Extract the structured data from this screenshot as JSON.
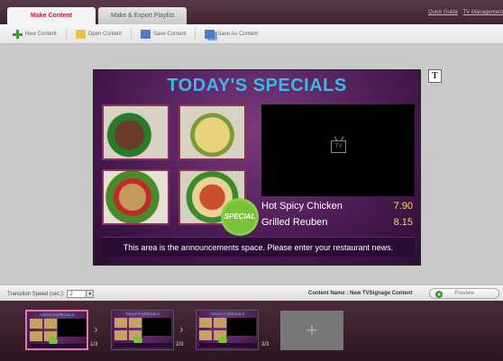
{
  "tabs": [
    {
      "label": "Make Content",
      "active": true
    },
    {
      "label": "Make & Export Playlist",
      "active": false
    }
  ],
  "toplinks": [
    "Quick Guide",
    "TV Management"
  ],
  "toolbar": {
    "new": "New Content",
    "open": "Open Content",
    "save": "Save Content",
    "save_as": "Save As Content"
  },
  "slide": {
    "title": "TODAY'S SPECIALS",
    "special_badge": "SPECIAL",
    "tv_label": "TV",
    "menu": [
      {
        "item": "Hot Spicy Chicken",
        "price": "7.90"
      },
      {
        "item": "Grilled Reuben",
        "price": "8.15"
      }
    ],
    "announcement": "This area is the announcements space. Please enter your restaurant news."
  },
  "text_tool": "T",
  "status": {
    "speed_label": "Transition Speed (sec.):",
    "speed_value": "2",
    "content_name": "Content Name : New TVSignage Content",
    "preview": "Preview"
  },
  "filmstrip": {
    "thumb_title": "TODAY'S SPECIALS",
    "counts": [
      "1/3",
      "2/3",
      "3/3"
    ],
    "add_label": "+"
  },
  "colors": {
    "accent": "#c0143c",
    "title_blue": "#3fb6e8",
    "price_yellow": "#f0e040",
    "slide_bg": "#4a1a52"
  }
}
